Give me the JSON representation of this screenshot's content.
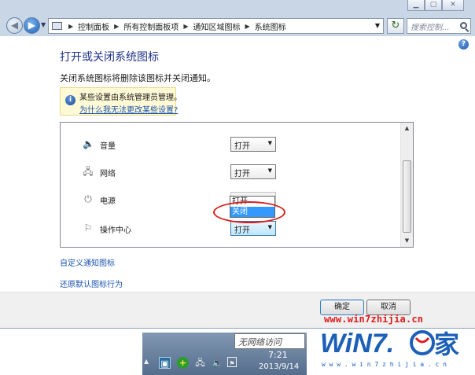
{
  "breadcrumbs": [
    "控制面板",
    "所有控制面板项",
    "通知区域图标",
    "系统图标"
  ],
  "search_placeholder": "搜索控制...",
  "page": {
    "title": "打开或关闭系统图标",
    "subtitle": "关闭系统图标将删除该图标并关闭通知。"
  },
  "info": {
    "text": "某些设置由系统管理员管理。",
    "link": "为什么我无法更改某些设置?"
  },
  "rows": [
    {
      "label": "音量",
      "value": "打开",
      "icon": "speaker-icon"
    },
    {
      "label": "网络",
      "value": "打开",
      "icon": "network-icon"
    },
    {
      "label": "电源",
      "value": "关闭",
      "icon": "power-icon",
      "disabled": true
    },
    {
      "label": "操作中心",
      "value": "打开",
      "icon": "flag-icon",
      "open": true
    }
  ],
  "dropdown_options": [
    "打开",
    "关闭"
  ],
  "dropdown_selected": "关闭",
  "links": {
    "customize": "自定义通知图标",
    "restore": "还原默认图标行为"
  },
  "buttons": {
    "ok": "确定",
    "cancel": "取消"
  },
  "watermark_url": "www.win7zhijia.cn",
  "taskbar": {
    "tooltip": "无网络访问",
    "time": "7:21",
    "date": "2013/9/14"
  },
  "colors": {
    "title_blue": "#1e3287",
    "link_blue": "#1b54b0",
    "highlight_red": "#d81e1e",
    "selection_blue": "#3399ff"
  }
}
